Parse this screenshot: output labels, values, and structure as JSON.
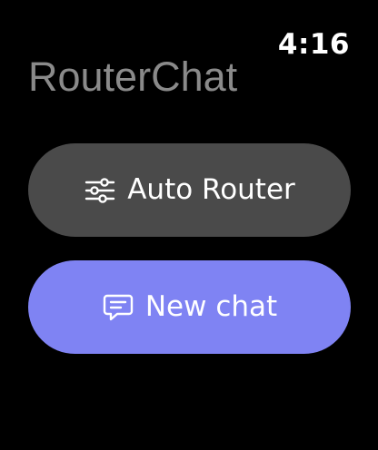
{
  "status_bar": {
    "time": "4:16"
  },
  "header": {
    "app_title": "RouterChat"
  },
  "actions": {
    "auto_router": {
      "label": "Auto Router",
      "icon": "sliders-icon"
    },
    "new_chat": {
      "label": "New chat",
      "icon": "chat-bubble-icon"
    }
  },
  "colors": {
    "background": "#000000",
    "title_text": "#8a8a8a",
    "auto_router_button": "#4a4a4a",
    "new_chat_button": "#7f83f3",
    "button_text": "#ffffff"
  }
}
